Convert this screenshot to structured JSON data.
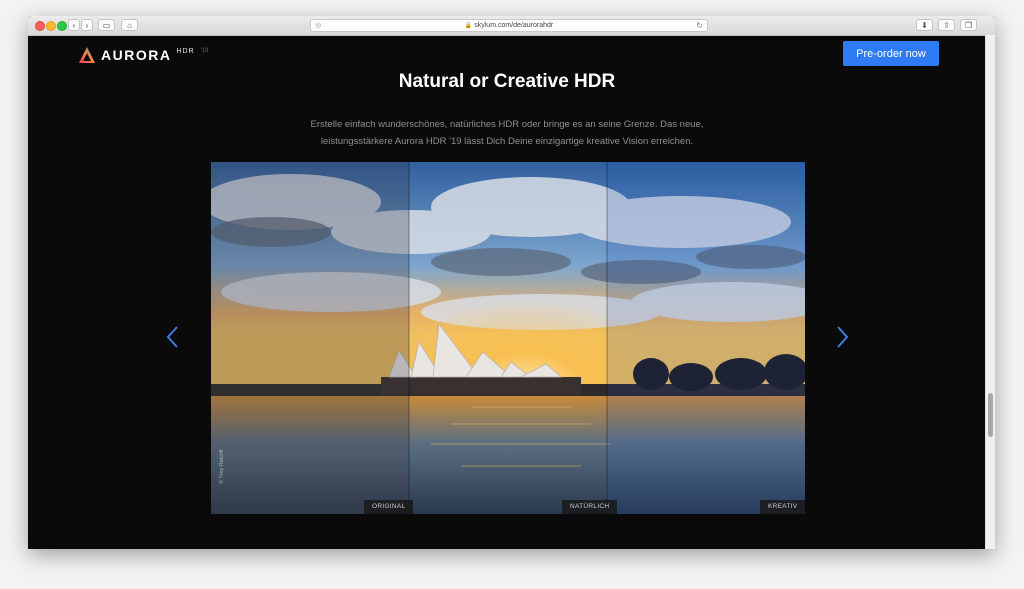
{
  "browser": {
    "url": "skylum.com/de/aurorahdr"
  },
  "header": {
    "brand": "AURORA",
    "brand_sub": "HDR",
    "brand_version": "'19",
    "cta_label": "Pre-order now"
  },
  "hero": {
    "title": "Natural or Creative HDR",
    "description": "Erstelle einfach wunderschönes, natürliches HDR oder bringe es an seine Grenze. Das neue, leistungsstärkere Aurora HDR '19 lässt Dich Deine einzigartige kreative Vision erreichen."
  },
  "comparison": {
    "labels": [
      "ORIGINAL",
      "NATÜRLICH",
      "KREATIV"
    ],
    "credit": "© Trey Ratcliff"
  },
  "colors": {
    "accent": "#2f7bf5",
    "background": "#0a0a0b",
    "arrow": "#3d7de0"
  },
  "icons": {
    "prev": "chevron-left-icon",
    "next": "chevron-right-icon"
  }
}
